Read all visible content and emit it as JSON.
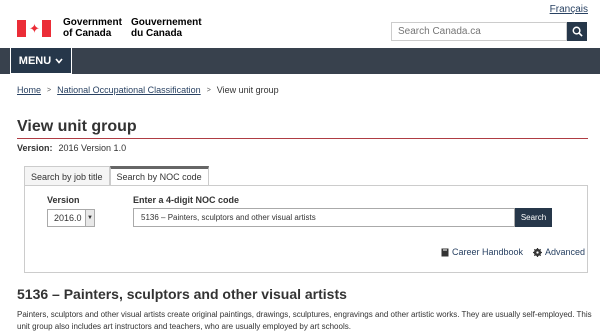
{
  "header": {
    "language_link": "Français",
    "signature_en": "Government\nof Canada",
    "signature_fr": "Gouvernement\ndu Canada",
    "search_placeholder": "Search Canada.ca"
  },
  "menu": {
    "label": "MENU"
  },
  "breadcrumb": {
    "items": [
      "Home",
      "National Occupational Classification",
      "View unit group"
    ],
    "separator": ">"
  },
  "page": {
    "title": "View unit group",
    "version_label": "Version:",
    "version_value": "2016 Version 1.0"
  },
  "tabs": [
    "Search by job title",
    "Search by NOC code"
  ],
  "form": {
    "version_label": "Version",
    "version_selected": "2016.0",
    "noc_label": "Enter a 4-digit NOC code",
    "noc_value": "5136 – Painters, sculptors and other visual artists",
    "search_button": "Search"
  },
  "tools": {
    "career_handbook": "Career Handbook",
    "advanced": "Advanced"
  },
  "result": {
    "heading": "5136 – Painters, sculptors and other visual artists",
    "description": "Painters, sculptors and other visual artists create original paintings, drawings, sculptures, engravings and other artistic works. They are usually self-employed. This unit group also includes art instructors and teachers, who are usually employed by art schools."
  },
  "colors": {
    "accent_red": "#af3c43",
    "flag_red": "#eb2d37",
    "navy": "#26374a",
    "link": "#284162"
  }
}
